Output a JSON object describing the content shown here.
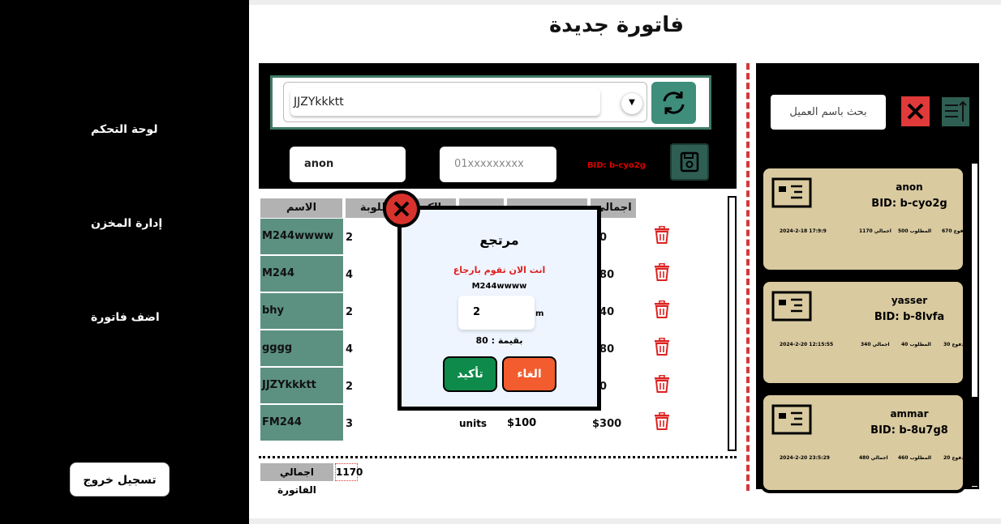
{
  "page": {
    "title": "فاتورة جديدة"
  },
  "sidebar": {
    "items": [
      {
        "label": "لوحة التحكم"
      },
      {
        "label": "إدارة المخزن"
      },
      {
        "label": "اضف فاتورة"
      }
    ],
    "logout_label": "تسجيل خروج"
  },
  "invoice": {
    "selected_product": "JJZYkkktt",
    "customer_name": "anon",
    "phone_placeholder": "01xxxxxxxxx",
    "bid": "BID: b-cyo2g",
    "columns": [
      "الاسم",
      "الكمية المطلوبة",
      "",
      "",
      "اجمالي"
    ],
    "rows": [
      {
        "name": "M244wwww",
        "qty": "2",
        "total": "80"
      },
      {
        "name": "M244",
        "qty": "4",
        "total": "280"
      },
      {
        "name": "bhy",
        "qty": "2",
        "total": "140"
      },
      {
        "name": "gggg",
        "qty": "4",
        "total": "280"
      },
      {
        "name": "JJZYkkktt",
        "qty": "2",
        "total": "90"
      },
      {
        "name": "FM244",
        "qty": "3",
        "unit": "units",
        "price": "$100",
        "total": "$300"
      }
    ],
    "total_label": "اجمالي الفاتورة",
    "total_value": "1170"
  },
  "modal": {
    "title": "مرتجع",
    "warning": "انت الان تقوم بارجاع",
    "item": "M244wwww",
    "quantity": "2",
    "unit": "m",
    "value_text": "بقيمة : 80",
    "cancel_label": "الغاء",
    "confirm_label": "تأكيد"
  },
  "clients": {
    "search_placeholder": "بحث باسم العميل",
    "cards": [
      {
        "name": "anon",
        "bid": "BID: b-cyo2g",
        "paid": "المدفوع 670",
        "required": "المطلوب 500",
        "total": "اجمالي 1170",
        "date": "2024-2-18 17:9:9"
      },
      {
        "name": "yasser",
        "bid": "BID: b-8lvfa",
        "paid": "المدفوع 30",
        "required": "المطلوب 40",
        "total": "اجمالي 340",
        "date": "2024-2-20 12:15:55"
      },
      {
        "name": "ammar",
        "bid": "BID: b-8u7g8",
        "paid": "المدفوع 20",
        "required": "المطلوب 460",
        "total": "اجمالي 480",
        "date": "2024-2-20 23:5:29"
      }
    ]
  },
  "colors": {
    "accent": "#3f8d7b",
    "danger": "#e03a3a",
    "card": "#d9caa0"
  }
}
